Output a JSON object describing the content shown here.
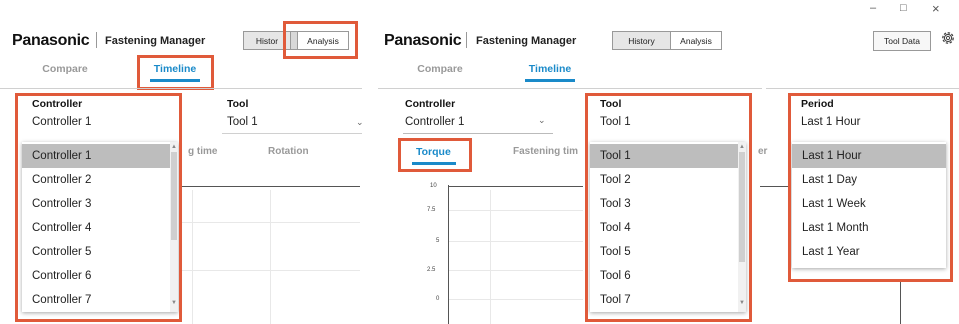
{
  "brand": "Panasonic",
  "app_title": "Fastening Manager",
  "history_label": "History",
  "history_truncated": "Histor",
  "analysis_label": "Analysis",
  "tabs": {
    "compare": "Compare",
    "timeline": "Timeline"
  },
  "metric_tabs": {
    "torque": "Torque",
    "fastening_time": "Fastening time",
    "fastening_time_partial": "g time",
    "fastening_time_clip": "Fastening tim",
    "rotation": "Rotation"
  },
  "fields": {
    "controller_label": "Controller",
    "controller_value": "Controller 1",
    "tool_label": "Tool",
    "tool_value": "Tool 1",
    "period_label": "Period",
    "period_value": "Last 1 Hour"
  },
  "controller_options": [
    "Controller 1",
    "Controller 2",
    "Controller 3",
    "Controller 4",
    "Controller 5",
    "Controller 6",
    "Controller 7"
  ],
  "tool_options": [
    "Tool 1",
    "Tool 2",
    "Tool 3",
    "Tool 4",
    "Tool 5",
    "Tool 6",
    "Tool 7"
  ],
  "period_options": [
    "Last 1 Hour",
    "Last 1 Day",
    "Last 1 Week",
    "Last 1 Month",
    "Last 1 Year"
  ],
  "y_ticks": [
    "10",
    "7.5",
    "5",
    "2.5",
    "0"
  ],
  "tool_data_label": "Tool Data",
  "window": {
    "minimize": "–",
    "maximize": "□",
    "close": "×"
  },
  "colors": {
    "accent": "#1a8ac9",
    "highlight": "#e05a3a",
    "selected": "#bdbdbd"
  },
  "icons": {
    "settings": "gear-icon",
    "dropdown": "chevron-down-icon"
  }
}
